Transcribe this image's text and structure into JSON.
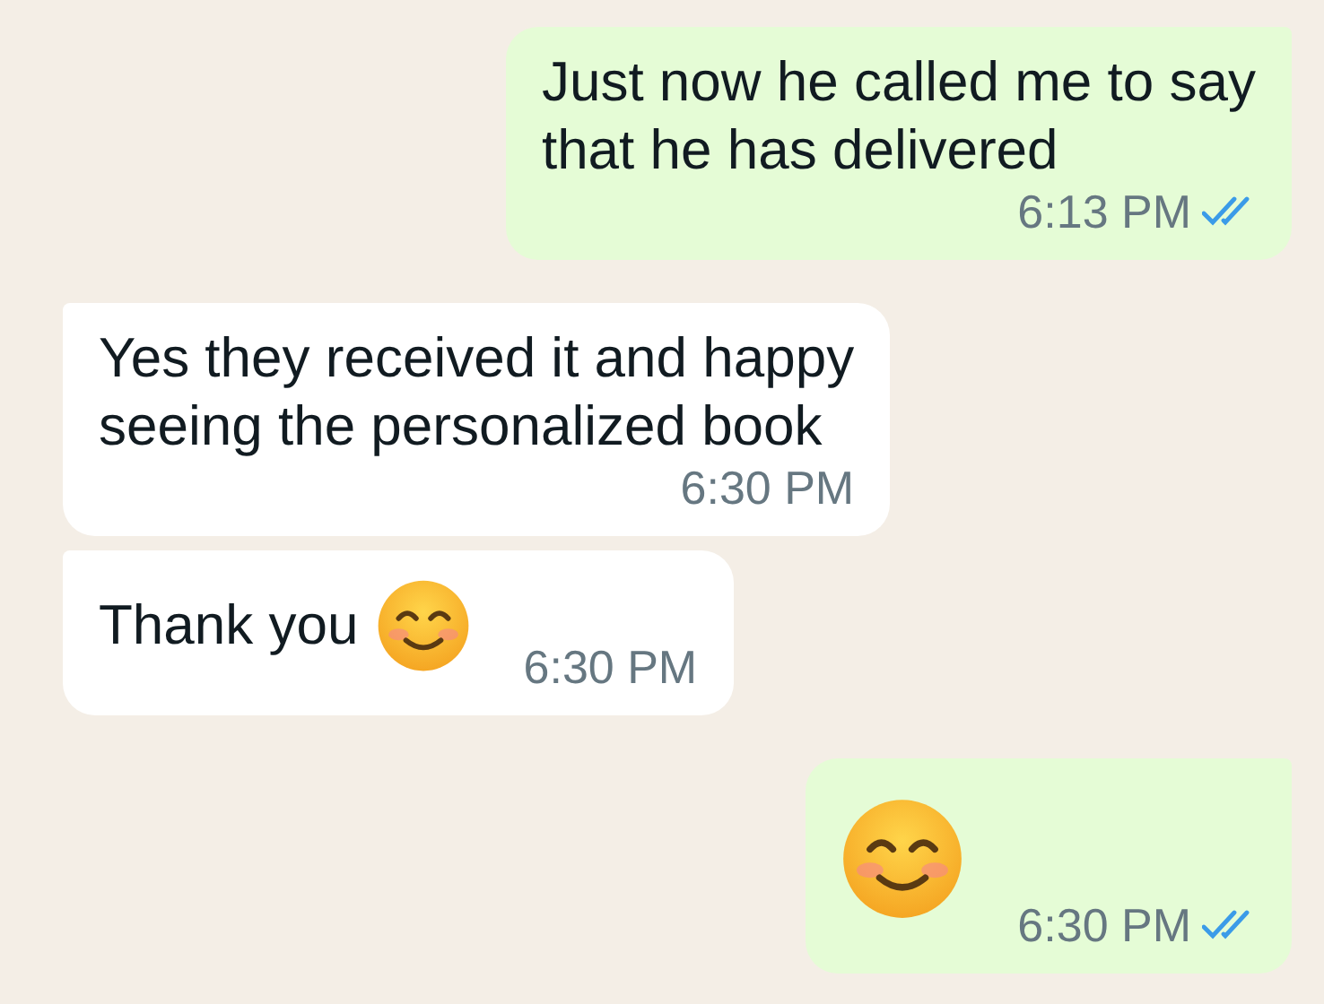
{
  "messages": [
    {
      "outgoing": true,
      "kind": "text",
      "text": "Just now he called me to say\nthat he has delivered",
      "time": "6:13 PM",
      "read": true
    },
    {
      "outgoing": false,
      "kind": "text",
      "text": "Yes they received it and happy\nseeing the personalized book",
      "time": "6:30 PM"
    },
    {
      "outgoing": false,
      "kind": "text_emoji",
      "text": "Thank you",
      "time": "6:30 PM"
    },
    {
      "outgoing": true,
      "kind": "emoji",
      "time": "6:30 PM",
      "read": true
    }
  ]
}
